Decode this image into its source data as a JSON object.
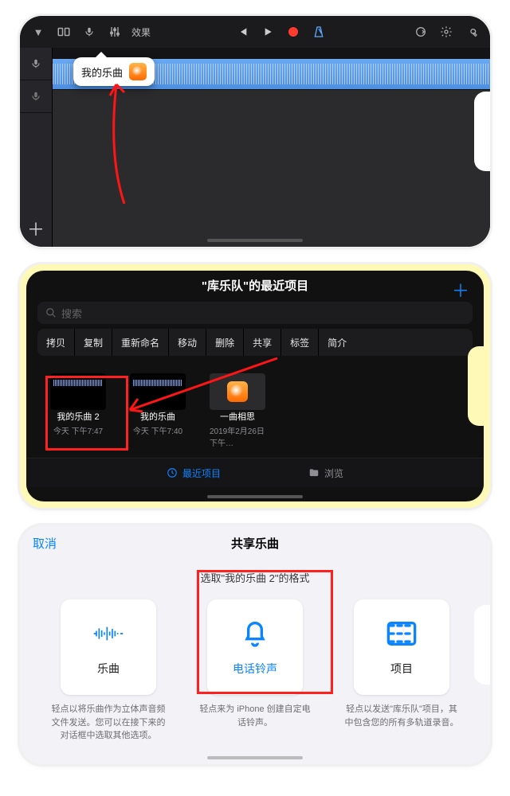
{
  "panel1": {
    "fx_label": "效果",
    "popover_song_name": "我的乐曲"
  },
  "panel2": {
    "title": "\"库乐队\"的最近项目",
    "search_placeholder": "搜索",
    "menu": [
      "拷贝",
      "复制",
      "重新命名",
      "移动",
      "删除",
      "共享",
      "标签",
      "简介"
    ],
    "projects": [
      {
        "name": "我的乐曲 2",
        "date": "今天 下午7:47"
      },
      {
        "name": "我的乐曲",
        "date": "今天 下午7:40"
      },
      {
        "name": "一曲相思",
        "date": "2019年2月26日 下午…"
      }
    ],
    "tab_recent": "最近项目",
    "tab_browse": "浏览"
  },
  "panel3": {
    "cancel": "取消",
    "title": "共享乐曲",
    "subtitle": "选取\"我的乐曲 2\"的格式",
    "cards": [
      {
        "label": "乐曲",
        "desc": "轻点以将乐曲作为立体声音频文件发送。您可以在接下来的对话框中选取其他选项。"
      },
      {
        "label": "电话铃声",
        "desc": "轻点来为 iPhone 创建自定电话铃声。"
      },
      {
        "label": "项目",
        "desc": "轻点以发送\"库乐队\"项目，其中包含您的所有多轨道录音。"
      }
    ]
  }
}
